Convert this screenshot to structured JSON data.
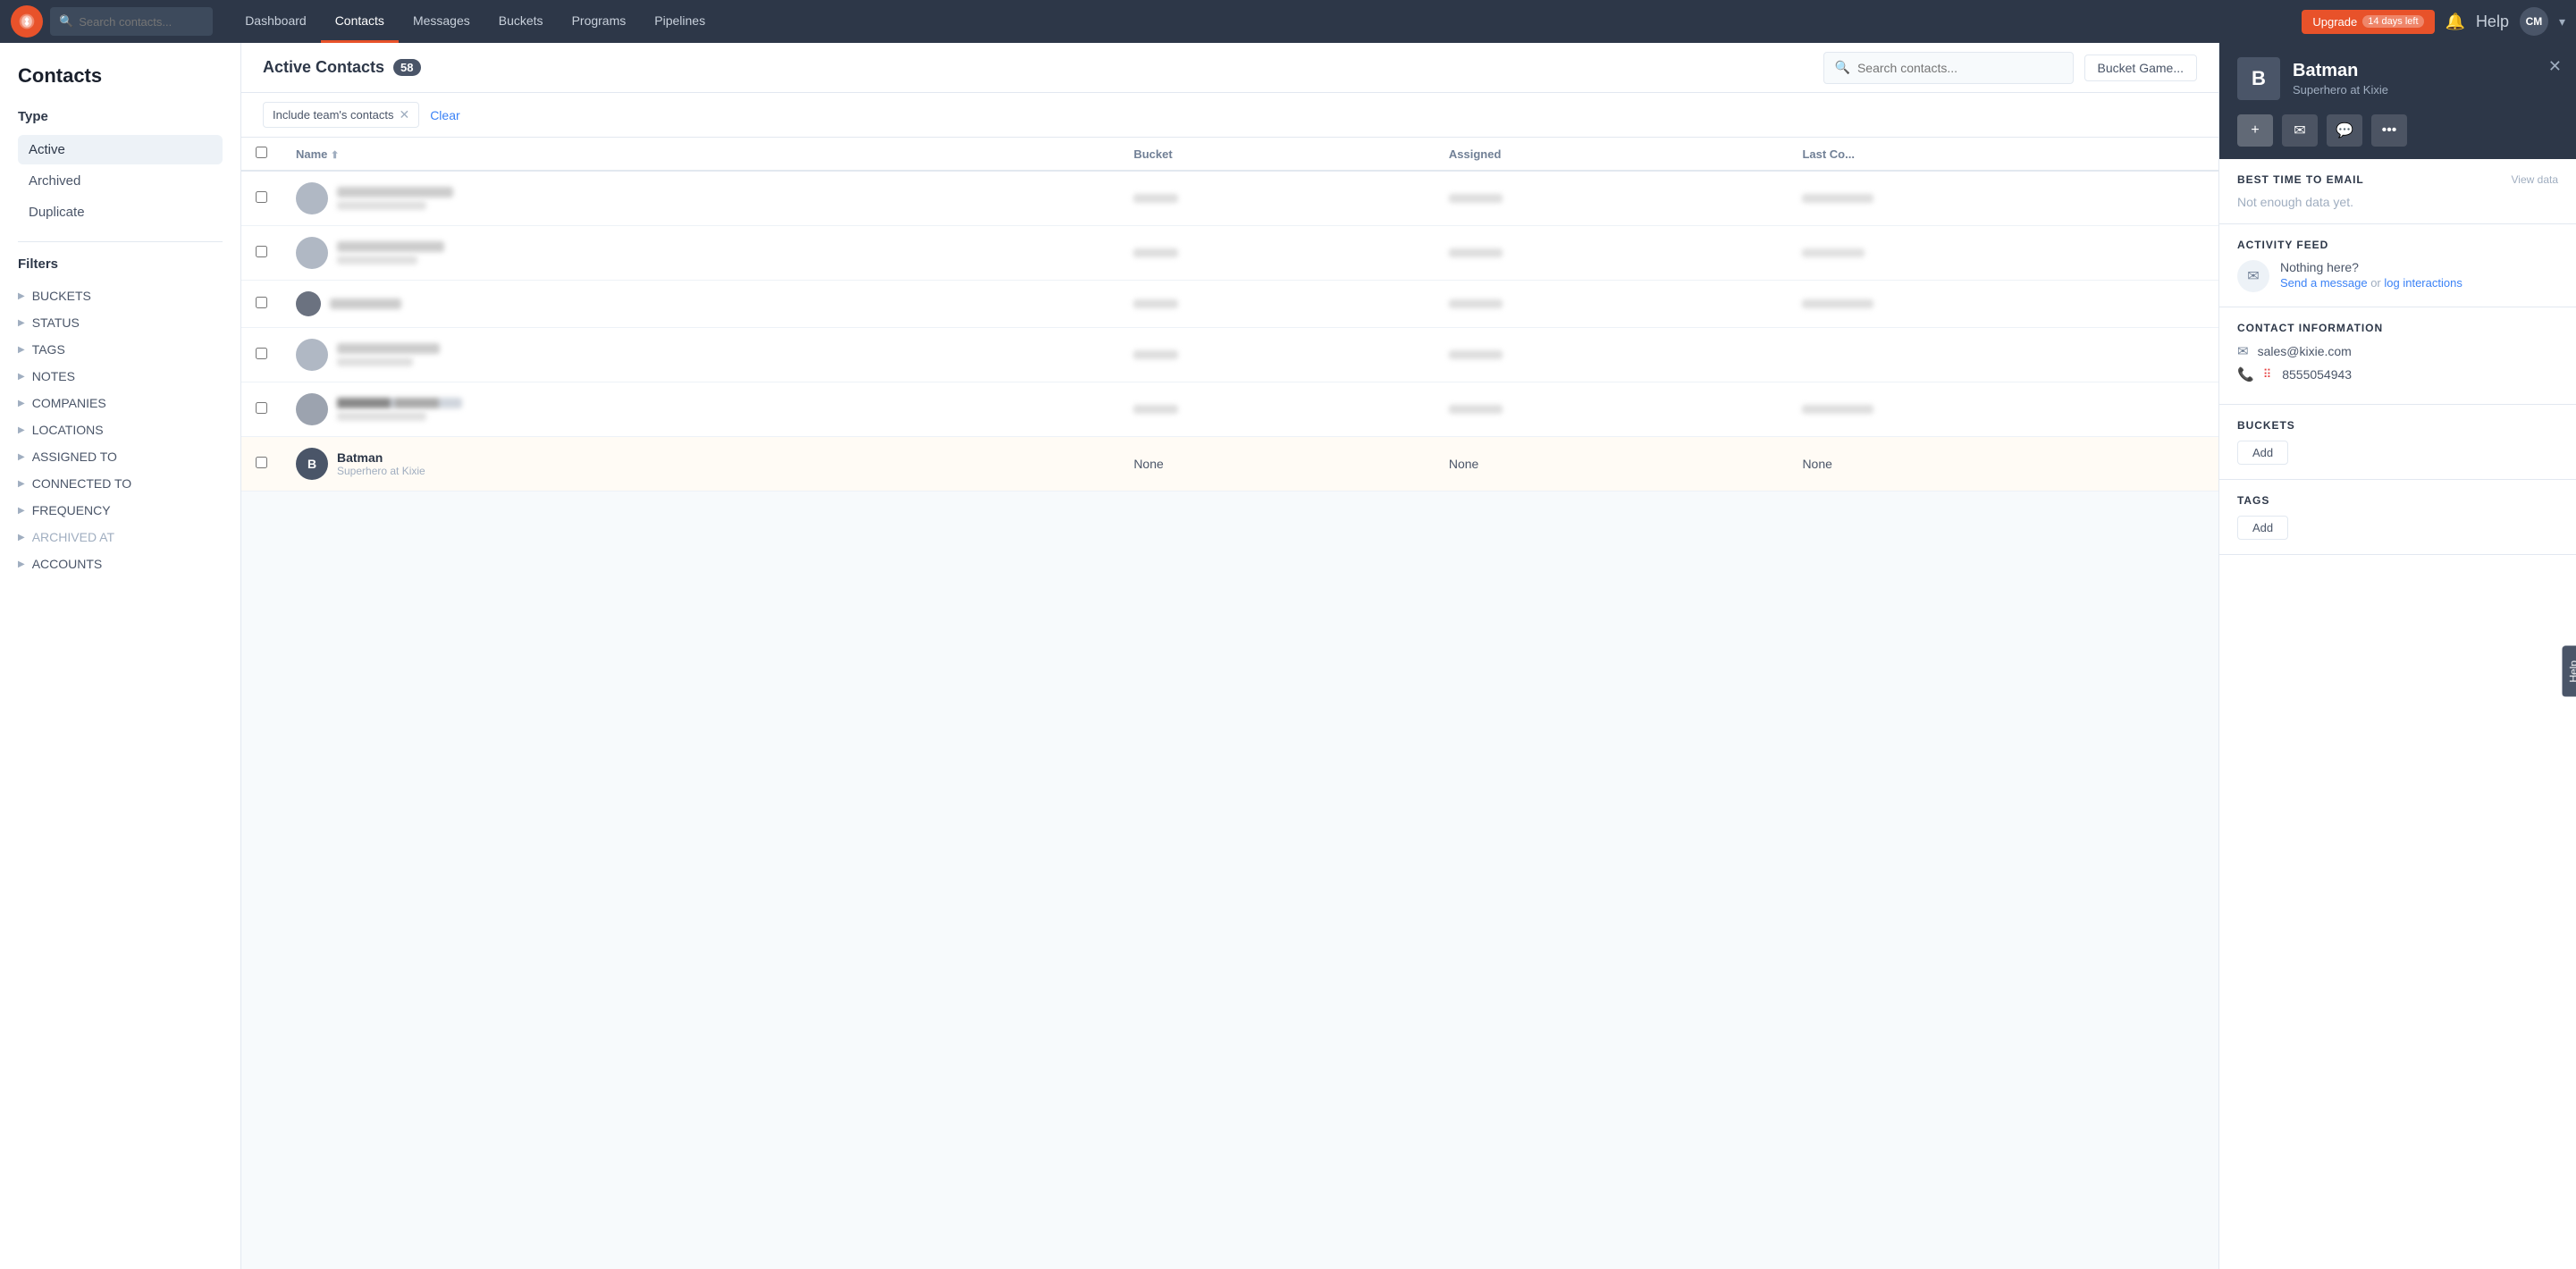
{
  "nav": {
    "logo_text": "K",
    "search_placeholder": "Search contacts...",
    "links": [
      {
        "label": "Dashboard",
        "active": false
      },
      {
        "label": "Contacts",
        "active": true
      },
      {
        "label": "Messages",
        "active": false
      },
      {
        "label": "Buckets",
        "active": false
      },
      {
        "label": "Programs",
        "active": false
      },
      {
        "label": "Pipelines",
        "active": false
      }
    ],
    "upgrade_label": "Upgrade",
    "upgrade_badge": "14 days left",
    "help_label": "Help",
    "avatar_initials": "CM"
  },
  "sidebar": {
    "page_title": "Contacts",
    "type_label": "Type",
    "type_items": [
      {
        "label": "Active",
        "active": true
      },
      {
        "label": "Archived",
        "active": false
      },
      {
        "label": "Duplicate",
        "active": false
      }
    ],
    "filters_label": "Filters",
    "filter_items": [
      {
        "label": "BUCKETS",
        "dimmed": false
      },
      {
        "label": "STATUS",
        "dimmed": false
      },
      {
        "label": "TAGS",
        "dimmed": false
      },
      {
        "label": "NOTES",
        "dimmed": false
      },
      {
        "label": "COMPANIES",
        "dimmed": false
      },
      {
        "label": "LOCATIONS",
        "dimmed": false
      },
      {
        "label": "ASSIGNED TO",
        "dimmed": false
      },
      {
        "label": "CONNECTED TO",
        "dimmed": false
      },
      {
        "label": "FREQUENCY",
        "dimmed": false
      },
      {
        "label": "ARCHIVED AT",
        "dimmed": true
      },
      {
        "label": "ACCOUNTS",
        "dimmed": false
      }
    ]
  },
  "content": {
    "heading": "Active Contacts",
    "count": "58",
    "search_placeholder": "Search contacts...",
    "bucket_btn": "Bucket Game...",
    "filter_tag": "Include team's contacts",
    "clear_label": "Clear",
    "table": {
      "columns": [
        "Name",
        "Bucket",
        "Assigned",
        "Last Co..."
      ],
      "rows": [
        {
          "blurred": true,
          "name": "",
          "sub": "",
          "bucket": "",
          "assigned": "",
          "lastco": "",
          "avatar_color": "#b0b8c4"
        },
        {
          "blurred": true,
          "name": "",
          "sub": "",
          "bucket": "",
          "assigned": "",
          "lastco": "",
          "avatar_color": "#b0b8c4"
        },
        {
          "blurred": true,
          "name": "",
          "sub": "",
          "bucket": "",
          "assigned": "",
          "lastco": "",
          "avatar_color": "#6b7280"
        },
        {
          "blurred": true,
          "name": "",
          "sub": "",
          "bucket": "",
          "assigned": "",
          "lastco": "",
          "avatar_color": "#b0b8c4"
        },
        {
          "blurred": true,
          "name": "",
          "sub": "",
          "bucket": "",
          "assigned": "",
          "lastco": "",
          "avatar_color": "#9ca3af"
        },
        {
          "blurred": false,
          "name": "Batman",
          "sub": "Superhero at Kixie",
          "bucket": "None",
          "assigned": "None",
          "lastco": "None",
          "avatar_letter": "B",
          "avatar_color": "#4a5568"
        }
      ]
    }
  },
  "right_panel": {
    "avatar_letter": "B",
    "name": "Batman",
    "subtitle": "Superhero at Kixie",
    "actions": [
      {
        "label": "+",
        "primary": true
      },
      {
        "label": "✉",
        "primary": false
      },
      {
        "label": "💬",
        "primary": false
      },
      {
        "label": "•••",
        "primary": false
      }
    ],
    "best_time_section": {
      "title": "BEST TIME TO EMAIL",
      "view_data": "View data",
      "no_data": "Not enough data yet."
    },
    "activity_section": {
      "title": "ACTIVITY FEED",
      "nothing_text": "Nothing here?",
      "send_message": "Send a message",
      "or_text": " or ",
      "log_interactions": "log interactions"
    },
    "contact_info_section": {
      "title": "CONTACT INFORMATION",
      "email": "sales@kixie.com",
      "phone": "8555054943"
    },
    "buckets_section": {
      "title": "BUCKETS",
      "add_label": "Add"
    },
    "tags_section": {
      "title": "TAGS",
      "add_label": "Add"
    }
  },
  "help_tab": "Help"
}
